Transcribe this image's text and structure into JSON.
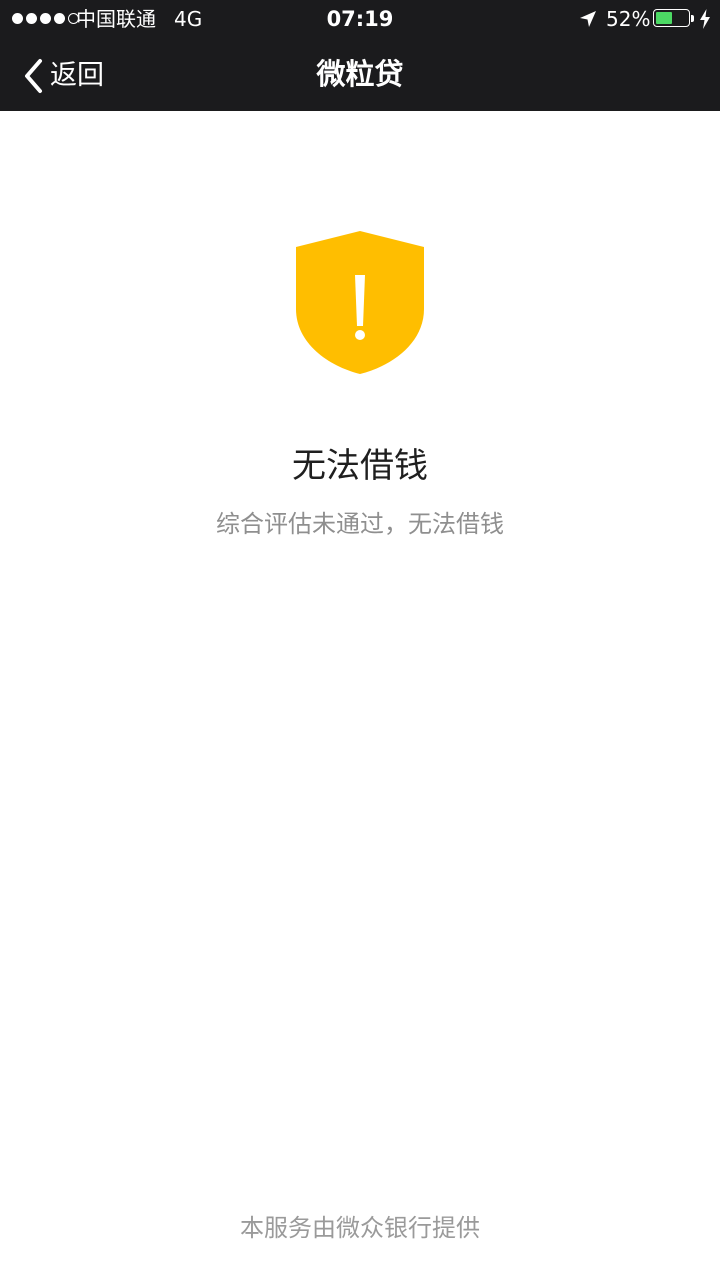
{
  "status_bar": {
    "carrier": "中国联通",
    "network": "4G",
    "time": "07:19",
    "battery_percent_text": "52%",
    "battery_level": 0.52,
    "battery_color": "#4cd964"
  },
  "nav": {
    "back_label": "返回",
    "title": "微粒贷",
    "back_icon": "chevron-left-icon",
    "background": "#1b1b1d"
  },
  "result": {
    "icon": "shield-warning-icon",
    "icon_color": "#ffbe00",
    "title": "无法借钱",
    "subtitle": "综合评估未通过，无法借钱"
  },
  "footer": {
    "text": "本服务由微众银行提供"
  }
}
